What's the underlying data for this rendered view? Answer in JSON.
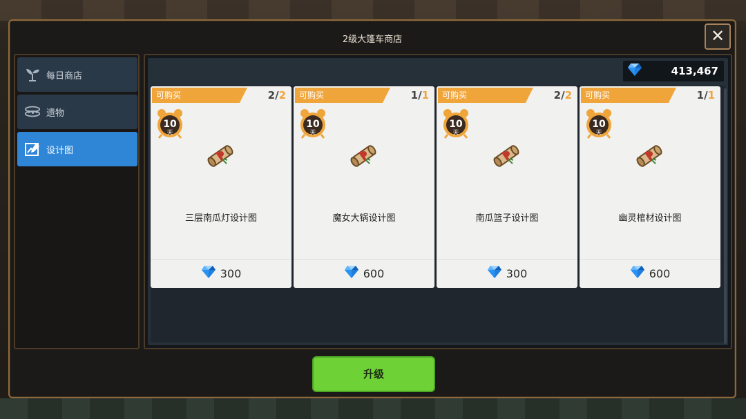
{
  "dialog": {
    "title": "2级大篷车商店",
    "close_label": "✕"
  },
  "sidebar": {
    "items": [
      {
        "label": "每日商店",
        "icon": "sprout-icon",
        "active": false
      },
      {
        "label": "遗物",
        "icon": "relic-icon",
        "active": false
      },
      {
        "label": "设计图",
        "icon": "blueprint-icon",
        "active": true
      }
    ]
  },
  "currency": {
    "icon": "diamond-icon",
    "amount": "413,467"
  },
  "cards": [
    {
      "tag": "可购买",
      "stock": "2",
      "max": "2",
      "timer_value": "10",
      "timer_unit": "天",
      "name": "三层南瓜灯设计图",
      "price": "300"
    },
    {
      "tag": "可购买",
      "stock": "1",
      "max": "1",
      "timer_value": "10",
      "timer_unit": "天",
      "name": "魔女大锅设计图",
      "price": "600"
    },
    {
      "tag": "可购买",
      "stock": "2",
      "max": "2",
      "timer_value": "10",
      "timer_unit": "天",
      "name": "南瓜篮子设计图",
      "price": "300"
    },
    {
      "tag": "可购买",
      "stock": "1",
      "max": "1",
      "timer_value": "10",
      "timer_unit": "天",
      "name": "幽灵棺材设计图",
      "price": "600"
    }
  ],
  "upgrade_label": "升级",
  "colors": {
    "accent_blue": "#2f86d6",
    "tag_orange": "#f0a53b",
    "upgrade_green": "#6ed236",
    "frame_gold": "#8d6a3d"
  }
}
